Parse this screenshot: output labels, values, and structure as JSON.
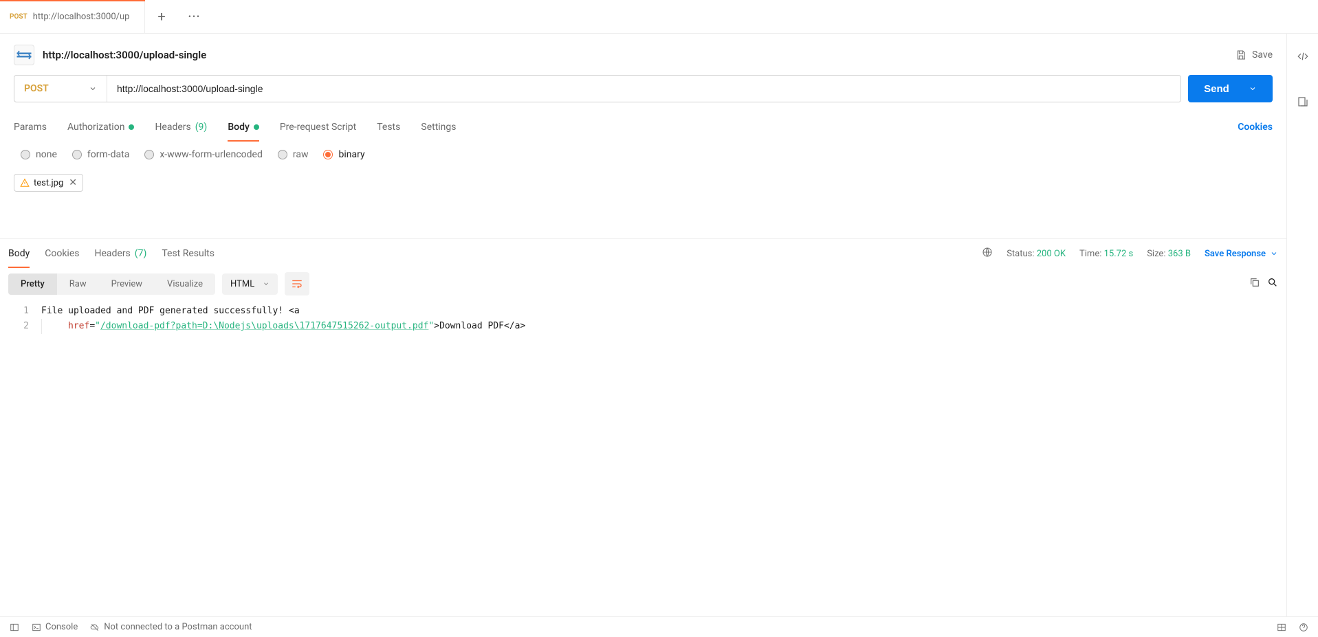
{
  "tab": {
    "method": "POST",
    "title": "http://localhost:3000/up"
  },
  "header": {
    "title": "http://localhost:3000/upload-single",
    "save": "Save"
  },
  "request": {
    "method": "POST",
    "url": "http://localhost:3000/upload-single",
    "send": "Send",
    "tabs": {
      "params": "Params",
      "authorization": "Authorization",
      "headers": "Headers",
      "headers_count": "(9)",
      "body": "Body",
      "prerequest": "Pre-request Script",
      "tests": "Tests",
      "settings": "Settings",
      "cookies": "Cookies"
    },
    "body_types": {
      "none": "none",
      "formdata": "form-data",
      "xwww": "x-www-form-urlencoded",
      "raw": "raw",
      "binary": "binary"
    },
    "file": "test.jpg"
  },
  "response": {
    "tabs": {
      "body": "Body",
      "cookies": "Cookies",
      "headers": "Headers",
      "headers_count": "(7)",
      "testresults": "Test Results"
    },
    "meta": {
      "status_label": "Status:",
      "status_value": "200 OK",
      "time_label": "Time:",
      "time_value": "15.72 s",
      "size_label": "Size:",
      "size_value": "363 B",
      "save": "Save Response"
    },
    "view": {
      "pretty": "Pretty",
      "raw": "Raw",
      "preview": "Preview",
      "visualize": "Visualize",
      "format": "HTML"
    },
    "body": {
      "line1_text": "File uploaded and PDF generated successfully! ",
      "line1_tag_open": "<",
      "line1_tag_name": "a",
      "line2_attr": "href",
      "line2_eq": "=",
      "line2_q1": "\"",
      "line2_href": "/download-pdf?path=D:\\Nodejs\\uploads\\1717647515262-output.pdf",
      "line2_q2": "\"",
      "line2_gt": ">",
      "line2_link_text": "Download PDF",
      "line2_close": "</",
      "line2_close_name": "a",
      "line2_close_gt": ">"
    }
  },
  "statusbar": {
    "console": "Console",
    "account": "Not connected to a Postman account"
  }
}
